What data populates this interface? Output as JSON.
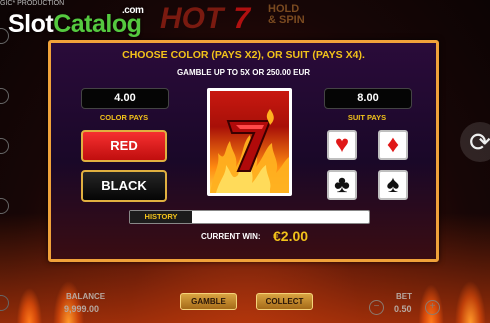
{
  "watermark": {
    "slot": "Slot",
    "catalog": "Catalog",
    "com": ".com"
  },
  "provider": "GIC* PRODUCTION",
  "game_logo": {
    "hot": "HOT",
    "seven": "7",
    "hold": "HOLD",
    "spin": "& SPIN"
  },
  "gamble": {
    "title": "CHOOSE COLOR (PAYS X2), OR SUIT (PAYS X4).",
    "subtitle": "GAMBLE UP TO 5X OR 250.00 EUR",
    "color_value": "4.00",
    "color_label": "COLOR PAYS",
    "suit_value": "8.00",
    "suit_label": "SUIT PAYS",
    "red_label": "RED",
    "black_label": "BLACK",
    "history_label": "HISTORY",
    "current_win_label": "CURRENT WIN:",
    "current_win_value": "€2.00"
  },
  "footer": {
    "balance_label": "BALANCE",
    "balance_value": "9,999.00",
    "gamble_label": "GAMBLE",
    "collect_label": "COLLECT",
    "bet_label": "BET",
    "bet_value": "0.50",
    "minus": "−",
    "plus": "+"
  },
  "suits": {
    "hearts": "♥",
    "diamonds": "♦",
    "clubs": "♣",
    "spades": "♠"
  },
  "refresh_icon": "⟳",
  "colors": {
    "accent_gold": "#f2c21a",
    "panel_border": "#f0a23a",
    "red_button": "#e01818",
    "black_button": "#111111"
  }
}
